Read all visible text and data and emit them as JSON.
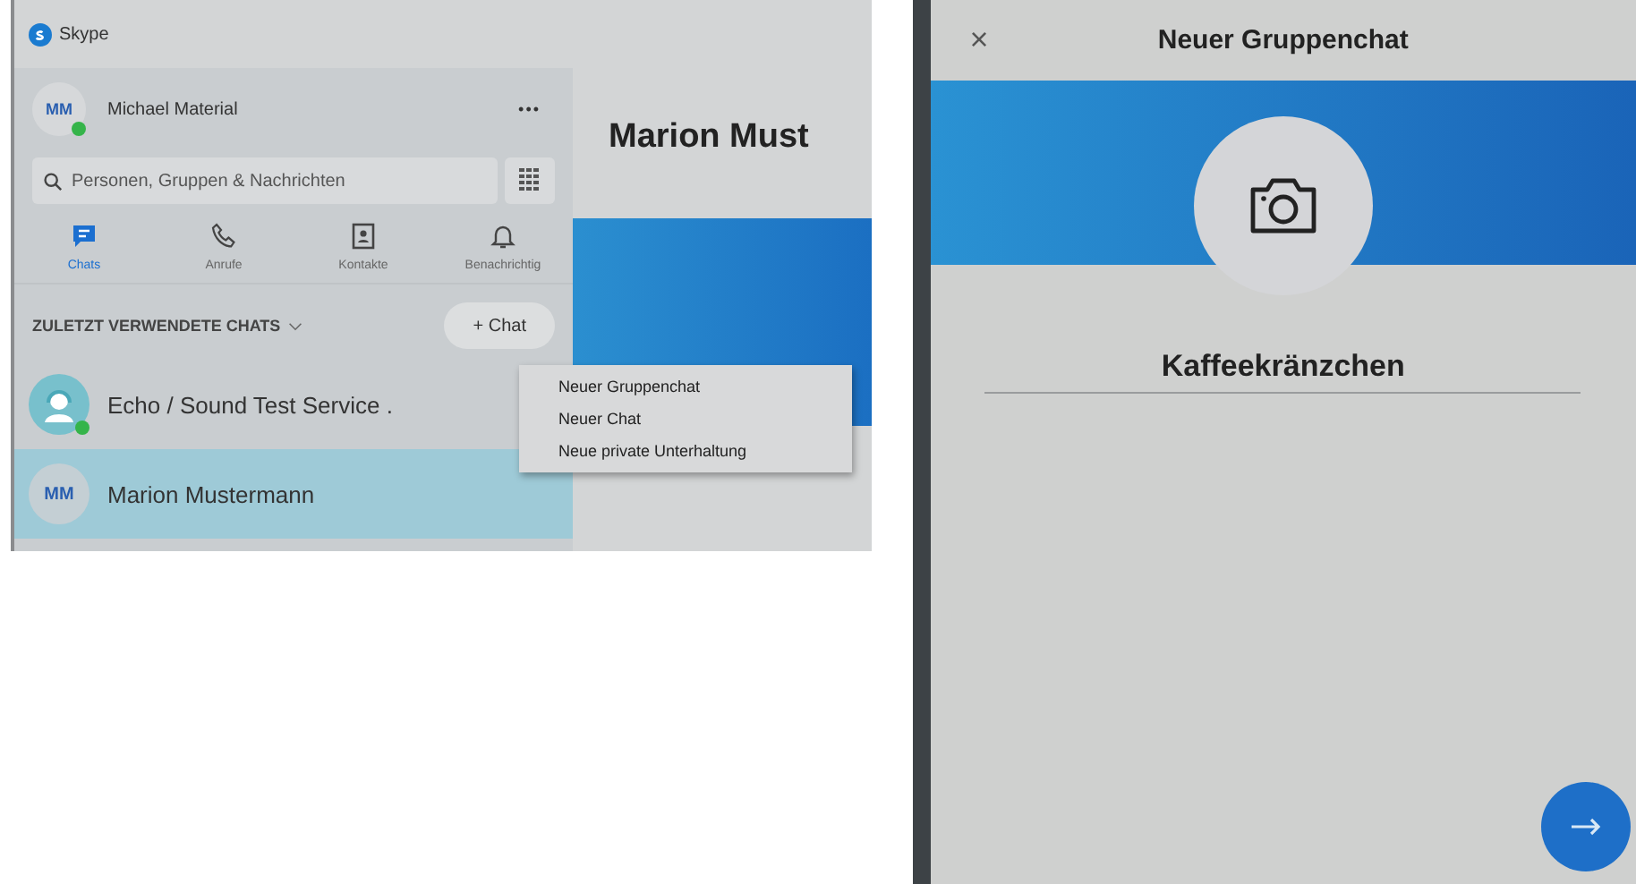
{
  "skype_window": {
    "title": "Skype",
    "profile": {
      "initials": "MM",
      "name": "Michael Material",
      "online": true,
      "more": "•••"
    },
    "search": {
      "placeholder": "Personen, Gruppen & Nachrichten"
    },
    "nav_tabs": [
      {
        "label": "Chats",
        "selected": true,
        "kind": "chat"
      },
      {
        "label": "Anrufe",
        "selected": false,
        "kind": "call"
      },
      {
        "label": "Kontakte",
        "selected": false,
        "kind": "contacts"
      },
      {
        "label": "Benachrichtig",
        "selected": false,
        "kind": "bell"
      }
    ],
    "section_header": "ZULETZT VERWENDETE CHATS",
    "new_chat_button": "+ Chat",
    "chat_menu": [
      "Neuer Gruppenchat",
      "Neuer Chat",
      "Neue private Unterhaltung"
    ],
    "chats": [
      {
        "name": "Echo / Sound Test Service .",
        "kind": "bot",
        "online": true,
        "selected": false
      },
      {
        "name": "Marion Mustermann",
        "kind": "initials",
        "initials": "MM",
        "online": false,
        "selected": true
      }
    ],
    "conversation_title": "Marion Must"
  },
  "group_dialog": {
    "close": "×",
    "title": "Neuer Gruppenchat",
    "group_name": "Kaffeekränzchen"
  }
}
